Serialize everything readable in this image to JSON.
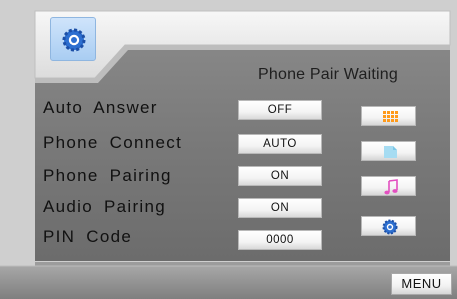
{
  "header": {
    "status_text": "Phone Pair Waiting",
    "settings_icon": "settings-gear-icon"
  },
  "settings": [
    {
      "label": "Auto  Answer",
      "value": "OFF"
    },
    {
      "label": "Phone  Connect",
      "value": "AUTO"
    },
    {
      "label": "Phone  Pairing",
      "value": "ON"
    },
    {
      "label": "Audio  Pairing",
      "value": "ON"
    },
    {
      "label": "PIN  Code",
      "value": "0000"
    }
  ],
  "side_buttons": [
    {
      "icon": "keypad-grid-icon",
      "color": "#ff9a1a"
    },
    {
      "icon": "phonebook-icon",
      "color": "#9fd8f0"
    },
    {
      "icon": "music-note-icon",
      "color": "#e34fc0"
    },
    {
      "icon": "settings-gear-icon",
      "color": "#2d6fd0"
    }
  ],
  "footer": {
    "menu_label": "MENU"
  },
  "colors": {
    "bezel": "#d8d8d8",
    "panel": "#7b7b7b",
    "bottom_bar": "#8e8e8e"
  }
}
